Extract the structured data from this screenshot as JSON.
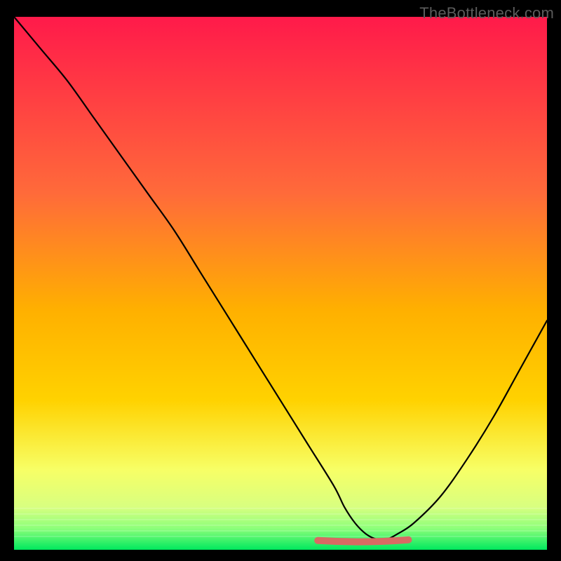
{
  "watermark": "TheBottleneck.com",
  "chart_data": {
    "type": "line",
    "title": "",
    "xlabel": "",
    "ylabel": "",
    "xlim": [
      0,
      100
    ],
    "ylim": [
      0,
      100
    ],
    "grid": false,
    "legend": false,
    "background_gradient_top": "#ff1a4a",
    "background_gradient_mid": "#ffd200",
    "background_gradient_bottom": "#00e85e",
    "series": [
      {
        "name": "bottleneck-curve",
        "color": "#000000",
        "x": [
          0,
          5,
          10,
          15,
          20,
          25,
          30,
          35,
          40,
          45,
          50,
          55,
          60,
          62,
          64,
          66,
          68,
          70,
          72,
          75,
          80,
          85,
          90,
          95,
          100
        ],
        "values": [
          100,
          94,
          88,
          81,
          74,
          67,
          60,
          52,
          44,
          36,
          28,
          20,
          12,
          8,
          5,
          3,
          2,
          2,
          3,
          5,
          10,
          17,
          25,
          34,
          43
        ]
      },
      {
        "name": "fit-band",
        "color": "#d86a63",
        "band_x_start": 57,
        "band_x_end": 74,
        "band_y": 2
      }
    ]
  },
  "plot": {
    "outer_size": 800,
    "inner_left": 20,
    "inner_top": 24,
    "inner_size": 760
  }
}
